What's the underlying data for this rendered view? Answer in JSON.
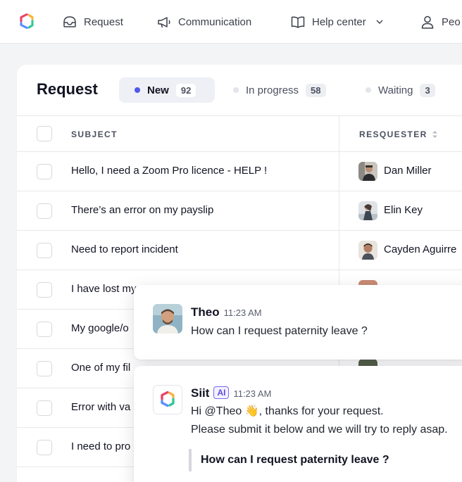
{
  "nav": {
    "items": [
      {
        "label": "Request",
        "icon": "request-icon"
      },
      {
        "label": "Communication",
        "icon": "megaphone-icon"
      },
      {
        "label": "Help center",
        "icon": "book-icon"
      },
      {
        "label": "Peo",
        "icon": "person-icon"
      }
    ],
    "brand_colors": [
      "#e7456b",
      "#5b8cff",
      "#35c79a",
      "#f6b440"
    ]
  },
  "page": {
    "title": "Request",
    "tabs": [
      {
        "label": "New",
        "count": "92",
        "dot_color": "#4f5ae6",
        "active": true
      },
      {
        "label": "In progress",
        "count": "58",
        "dot_color": "#e3e5ea",
        "active": false
      },
      {
        "label": "Waiting",
        "count": "3",
        "dot_color": "#e3e5ea",
        "active": false
      }
    ]
  },
  "table": {
    "headers": {
      "subject": "SUBJECT",
      "requester": "RESQUESTER"
    },
    "rows": [
      {
        "subject": "Hello, I need a Zoom Pro licence - HELP !",
        "requester": "Dan Miller"
      },
      {
        "subject": "There’s an error on my payslip",
        "requester": "Elin Key"
      },
      {
        "subject": "Need to report incident",
        "requester": "Cayden Aguirre"
      },
      {
        "subject": "I have lost my",
        "requester": ""
      },
      {
        "subject": "My google/o",
        "requester": ""
      },
      {
        "subject": "One of my fil",
        "requester": ""
      },
      {
        "subject": "Error with va",
        "requester": ""
      },
      {
        "subject": "I need to pro",
        "requester": ""
      }
    ]
  },
  "chat": {
    "message1": {
      "sender": "Theo",
      "time": "11:23 AM",
      "text": "How can I request paternity leave ?"
    },
    "message2": {
      "sender": "Siit",
      "badge": "AI",
      "time": "11:23 AM",
      "line1": "Hi @Theo 👋, thanks for your request.",
      "line2": "Please submit it below and we will try to reply asap.",
      "quote": "How can I request paternity leave ?"
    }
  }
}
